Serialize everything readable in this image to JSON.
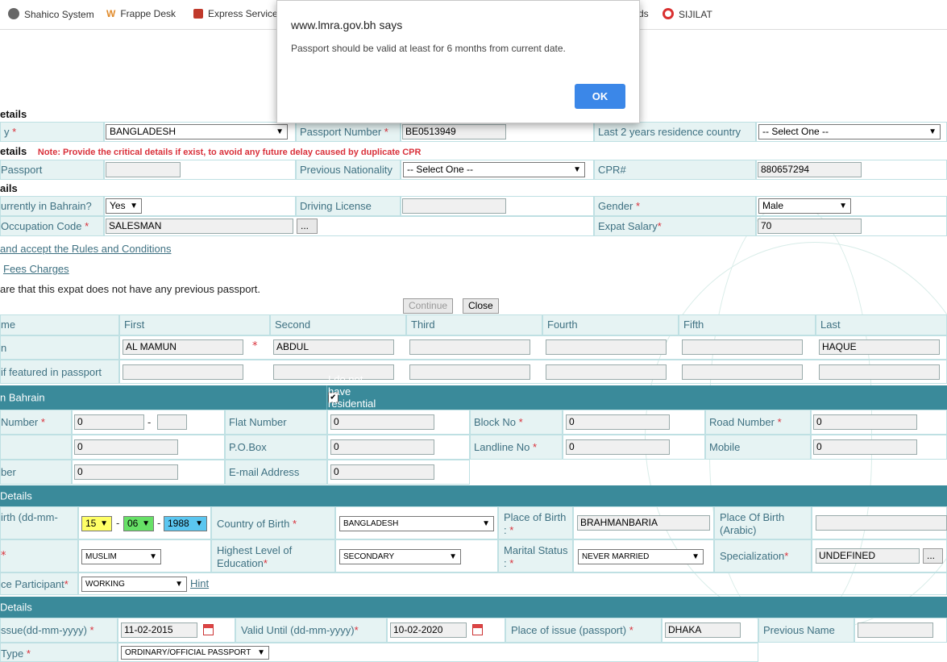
{
  "bookmarks": [
    {
      "label": "Shahico System"
    },
    {
      "label": "Frappe Desk"
    },
    {
      "label": "Express Services"
    },
    {
      "label": "ds"
    },
    {
      "label": "SIJILAT"
    }
  ],
  "dialog": {
    "title": "www.lmra.gov.bh says",
    "message": "Passport should be valid at least for 6 months from current date.",
    "ok": "OK"
  },
  "passport_section": {
    "header": "etails",
    "nationality_label": "y",
    "nationality_value": "BANGLADESH",
    "passport_number_label": "Passport Number",
    "passport_number_value": "BE0513949",
    "last2_label": "Last 2 years residence country",
    "last2_value": "-- Select One --"
  },
  "prev_section": {
    "header": "etails",
    "note": "Note: Provide the critical details if exist, to avoid any future delay caused by duplicate CPR",
    "passport_label": "Passport",
    "prev_nat_label": "Previous Nationality",
    "prev_nat_value": "-- Select One --",
    "cpr_label": "CPR#",
    "cpr_value": "880657294"
  },
  "other_section": {
    "header": "ails",
    "in_bahrain_label": "urrently in Bahrain?",
    "in_bahrain_value": "Yes",
    "driving_label": "Driving License",
    "gender_label": "Gender",
    "gender_value": "Male",
    "occ_label": "Occupation Code",
    "occ_value": "SALESMAN",
    "browse": "...",
    "salary_label": "Expat Salary",
    "salary_value": "70"
  },
  "links": {
    "rules": "and accept the Rules and Conditions",
    "fees": "Fees Charges",
    "declare": "are that this expat does not have any previous passport."
  },
  "buttons": {
    "continue": "Continue",
    "close": "Close"
  },
  "names": {
    "col_name": "me",
    "cols": [
      "First",
      "Second",
      "Third",
      "Fourth",
      "Fifth",
      "Last"
    ],
    "row1_label": "n",
    "row1_values": [
      "AL MAMUN",
      "ABDUL",
      "",
      "",
      "",
      "HAQUE"
    ],
    "row2_label": "if featured in passport"
  },
  "address": {
    "header": "n Bahrain",
    "no_address": "I do not have residential address",
    "number_label": "Number",
    "number_a": "0",
    "dash": "-",
    "flat_label": "Flat Number",
    "flat_value": "0",
    "block_label": "Block No",
    "block_value": "0",
    "road_label": "Road Number",
    "road_value": "0",
    "row2_value": "0",
    "pobox_label": "P.O.Box",
    "pobox_value": "0",
    "landline_label": "Landline No",
    "landline_value": "0",
    "mobile_label": "Mobile",
    "mobile_value": "0",
    "row3_label": "ber",
    "row3_value": "0",
    "email_label": "E-mail Address",
    "email_value": "0"
  },
  "personal": {
    "header": "Details",
    "dob_label": "irth (dd-mm-",
    "dob_day": "15",
    "dob_month": "06",
    "dob_year": "1988",
    "cob_label": "Country of Birth",
    "cob_value": "BANGLADESH",
    "pob_label": "Place of Birth",
    "pob_label2": ":",
    "pob_value": "BRAHMANBARIA",
    "pob_ar_label": "Place Of Birth",
    "pob_ar_label2": "(Arabic)",
    "religion_value": "MUSLIM",
    "edu_label": "Highest Level of",
    "edu_label2": "Education",
    "edu_value": "SECONDARY",
    "marital_label": "Marital Status",
    "marital_label2": ":",
    "marital_value": "NEVER MARRIED",
    "spec_label": "Specialization",
    "spec_value": "UNDEFINED",
    "participant_label": "ce Participant",
    "participant_value": "WORKING",
    "hint": "Hint"
  },
  "passport_details": {
    "header": "Details",
    "issue_label": "ssue(dd-mm-yyyy)",
    "issue_value": "11-02-2015",
    "valid_label": "Valid Until (dd-mm-yyyy)",
    "valid_value": "10-02-2020",
    "place_label": "Place of issue (passport)",
    "place_value": "DHAKA",
    "prev_name_label": "Previous Name",
    "type_label": "Type",
    "type_value": "ORDINARY/OFFICIAL PASSPORT"
  }
}
